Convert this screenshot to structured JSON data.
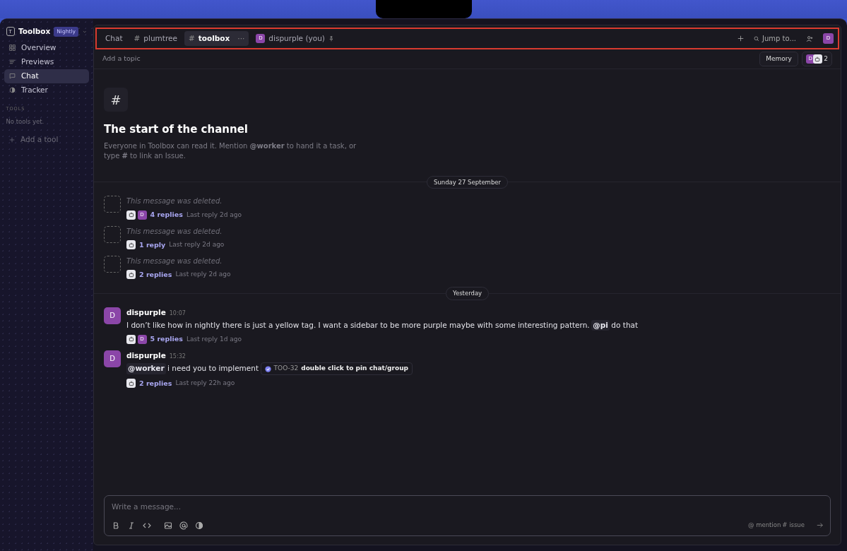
{
  "workspace": {
    "initial": "T",
    "name": "Toolbox",
    "badge": "Nightly"
  },
  "sidebar": {
    "items": [
      {
        "label": "Overview",
        "selected": false
      },
      {
        "label": "Previews",
        "selected": false
      },
      {
        "label": "Chat",
        "selected": true
      },
      {
        "label": "Tracker",
        "selected": false
      }
    ],
    "section_title": "TOOLS",
    "empty_text": "No tools yet.",
    "add_label": "Add a tool"
  },
  "tabs": [
    {
      "kind": "plain",
      "label": "Chat",
      "selected": false
    },
    {
      "kind": "channel",
      "prefix": "#",
      "label": "plumtree",
      "selected": false
    },
    {
      "kind": "channel",
      "prefix": "#",
      "label": "toolbox",
      "selected": true,
      "more": "···"
    },
    {
      "kind": "dm",
      "avatar": "D",
      "label": "dispurple (you)",
      "selected": false,
      "pinned": true
    }
  ],
  "toolbar": {
    "search_label": "Jump to...",
    "avatar": "D"
  },
  "topic_hint": "Add a topic",
  "memory_label": "Memory",
  "members": {
    "avatar": "D",
    "count": "2"
  },
  "intro": {
    "symbol": "#",
    "title": "The start of the channel",
    "text": "Everyone in Toolbox can read it. Mention **@worker** to hand it a task, or type **#** to link an Issue."
  },
  "groups": [
    {
      "date": "Sunday 27 September",
      "messages": [
        {
          "kind": "deleted",
          "text": "This message was deleted.",
          "thread": {
            "avatars": [
              {
                "kind": "bot"
              },
              {
                "kind": "user",
                "initial": "D"
              }
            ],
            "replies": "4 replies",
            "last": "Last reply 2d ago"
          }
        },
        {
          "kind": "deleted",
          "text": "This message was deleted.",
          "thread": {
            "avatars": [
              {
                "kind": "bot"
              }
            ],
            "replies": "1 reply",
            "last": "Last reply 2d ago"
          }
        },
        {
          "kind": "deleted",
          "text": "This message was deleted.",
          "thread": {
            "avatars": [
              {
                "kind": "bot"
              }
            ],
            "replies": "2 replies",
            "last": "Last reply 2d ago"
          }
        }
      ]
    },
    {
      "date": "Yesterday",
      "messages": [
        {
          "kind": "user",
          "avatar": "D",
          "author": "dispurple",
          "time": "10:07",
          "parts": [
            {
              "kind": "text",
              "text": "I don’t like how in nightly there is just a yellow tag. I want a sidebar to be more purple maybe with some interesting pattern."
            },
            {
              "kind": "mention",
              "text": "@pi"
            },
            {
              "kind": "text",
              "text": "do that"
            }
          ],
          "thread": {
            "avatars": [
              {
                "kind": "bot"
              },
              {
                "kind": "user",
                "initial": "D"
              }
            ],
            "replies": "5 replies",
            "last": "Last reply 1d ago"
          }
        },
        {
          "kind": "user",
          "avatar": "D",
          "author": "dispurple",
          "time": "15:32",
          "parts": [
            {
              "kind": "mention",
              "text": "@worker"
            },
            {
              "kind": "text",
              "text": "i need you to implement"
            },
            {
              "kind": "issue",
              "id": "TOO-32",
              "title": "double click to pin chat/group"
            }
          ],
          "thread": {
            "avatars": [
              {
                "kind": "bot"
              }
            ],
            "replies": "2 replies",
            "last": "Last reply 22h ago"
          }
        }
      ]
    }
  ],
  "composer": {
    "placeholder": "Write a message...",
    "hints": [
      "@ mention",
      "# issue"
    ]
  }
}
